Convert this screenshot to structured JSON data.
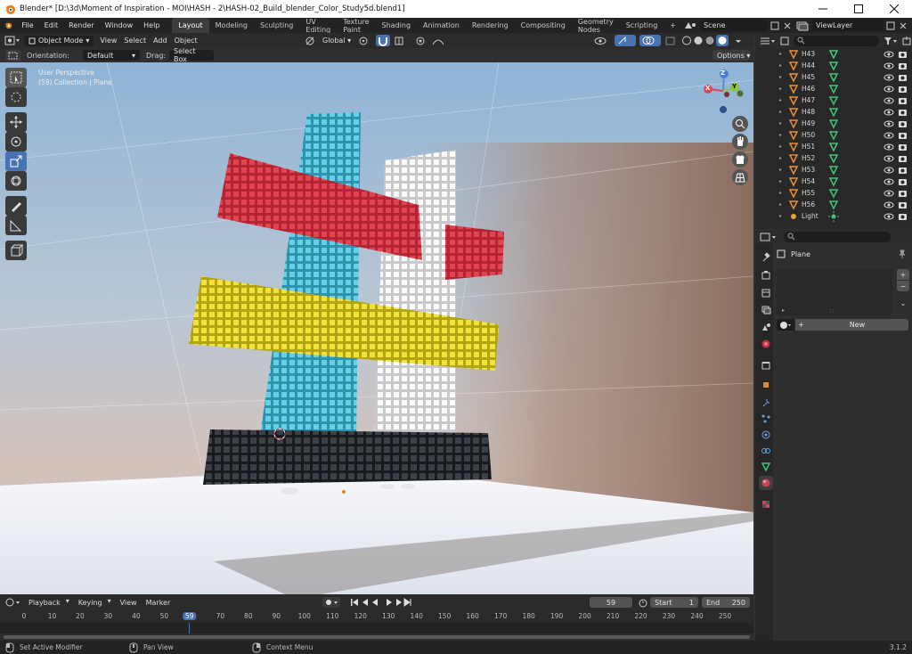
{
  "titlebar": {
    "title": "Blender* [D:\\3d\\Moment of Inspiration - MOI\\HASH - 2\\HASH-02_Build_blender_Color_Study5d.blend1]"
  },
  "menus": [
    "File",
    "Edit",
    "Render",
    "Window",
    "Help"
  ],
  "workspaces": [
    "Layout",
    "Modeling",
    "Sculpting",
    "UV Editing",
    "Texture Paint",
    "Shading",
    "Animation",
    "Rendering",
    "Compositing",
    "Geometry Nodes",
    "Scripting"
  ],
  "active_workspace": "Layout",
  "scene": "Scene",
  "view_layer": "ViewLayer",
  "viewport_header": {
    "mode": "Object Mode",
    "menus": [
      "View",
      "Select",
      "Add",
      "Object"
    ],
    "transform": "Global"
  },
  "tool_settings": {
    "orientation_label": "Orientation:",
    "orientation_value": "Default",
    "drag_label": "Drag:",
    "drag_value": "Select Box",
    "options": "Options"
  },
  "overlay_text": {
    "view": "User Perspective",
    "collection": "(59) Collection | Plane"
  },
  "gizmo": {
    "x": "X",
    "y": "Y",
    "z": "Z"
  },
  "outliner": {
    "items": [
      "H43",
      "H44",
      "H45",
      "H46",
      "H47",
      "H48",
      "H49",
      "H50",
      "H51",
      "H52",
      "H53",
      "H54",
      "H55",
      "H56",
      "Light"
    ]
  },
  "properties": {
    "object": "Plane",
    "new_button": "New"
  },
  "timeline": {
    "menus": [
      "Playback",
      "Keying",
      "View",
      "Marker"
    ],
    "current_frame": "59",
    "start_label": "Start",
    "start": "1",
    "end_label": "End",
    "end": "250",
    "ticks": [
      "0",
      "10",
      "20",
      "30",
      "40",
      "50",
      "59",
      "70",
      "80",
      "90",
      "100",
      "110",
      "120",
      "130",
      "140",
      "150",
      "160",
      "170",
      "180",
      "190",
      "200",
      "210",
      "220",
      "230",
      "240",
      "250"
    ]
  },
  "status": {
    "left": "Set Active Modifier",
    "middle": "Pan View",
    "right": "Context Menu",
    "version": "3.1.2"
  },
  "colors": {
    "accent": "#4772b3",
    "red": "#c9323e",
    "cyan": "#4ec2dc",
    "yellow": "#e6d51f",
    "white": "#f2f2f2",
    "dark": "#2a2d33"
  }
}
